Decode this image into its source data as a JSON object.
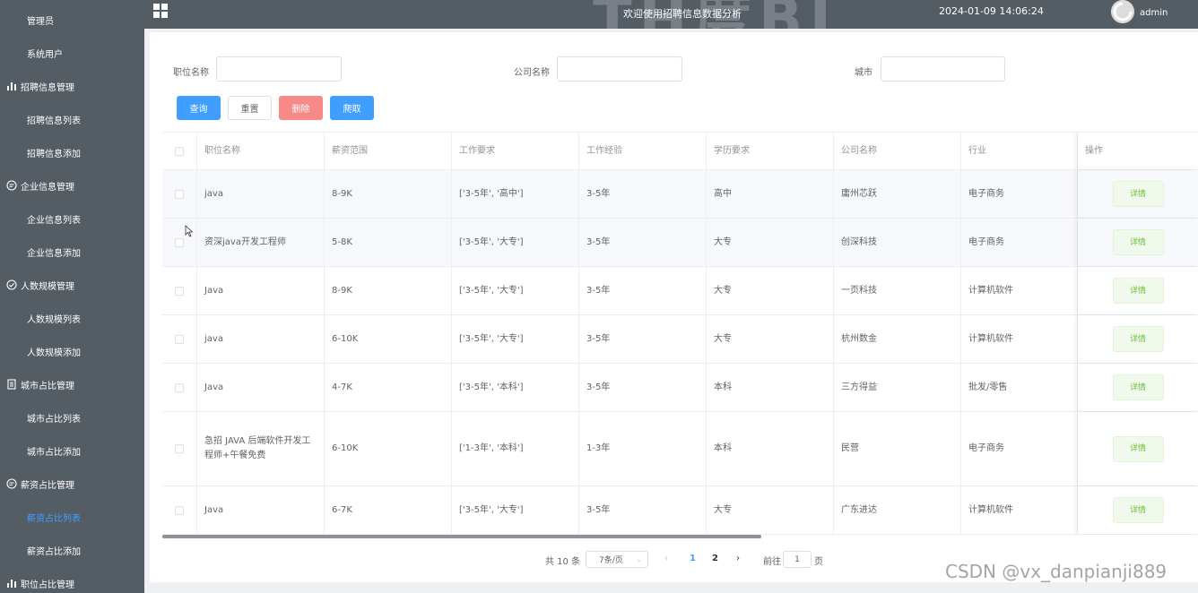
{
  "sidebar": {
    "items": [
      {
        "label": "管理员",
        "type": "child",
        "icon": "",
        "active": false
      },
      {
        "label": "系统用户",
        "type": "child",
        "icon": "",
        "active": false
      },
      {
        "label": "招聘信息管理",
        "type": "parent",
        "icon": "bar-chart-icon",
        "active": false
      },
      {
        "label": "招聘信息列表",
        "type": "child",
        "icon": "",
        "active": false
      },
      {
        "label": "招聘信息添加",
        "type": "child",
        "icon": "",
        "active": false
      },
      {
        "label": "企业信息管理",
        "type": "parent",
        "icon": "chat-icon",
        "active": false
      },
      {
        "label": "企业信息列表",
        "type": "child",
        "icon": "",
        "active": false
      },
      {
        "label": "企业信息添加",
        "type": "child",
        "icon": "",
        "active": false
      },
      {
        "label": "人数规模管理",
        "type": "parent",
        "icon": "check-circle-icon",
        "active": false
      },
      {
        "label": "人数规模列表",
        "type": "child",
        "icon": "",
        "active": false
      },
      {
        "label": "人数规模添加",
        "type": "child",
        "icon": "",
        "active": false
      },
      {
        "label": "城市占比管理",
        "type": "parent",
        "icon": "document-icon",
        "active": false
      },
      {
        "label": "城市占比列表",
        "type": "child",
        "icon": "",
        "active": false
      },
      {
        "label": "城市占比添加",
        "type": "child",
        "icon": "",
        "active": false
      },
      {
        "label": "薪资占比管理",
        "type": "parent",
        "icon": "chat-icon",
        "active": false
      },
      {
        "label": "薪资占比列表",
        "type": "child",
        "icon": "",
        "active": true
      },
      {
        "label": "薪资占比添加",
        "type": "child",
        "icon": "",
        "active": false
      },
      {
        "label": "职位占比管理",
        "type": "parent",
        "icon": "bar-chart-icon",
        "active": false
      }
    ],
    "active_color": "#409eff"
  },
  "header": {
    "title": "欢迎使用招聘信息数据分析",
    "time": "2024-01-09 14:06:24",
    "user": "admin",
    "bg_text": "TH度BL"
  },
  "search": {
    "job_label": "职位名称",
    "job_value": "",
    "company_label": "公司名称",
    "company_value": "",
    "city_label": "城市",
    "city_value": ""
  },
  "buttons": {
    "query": "查询",
    "reset": "重置",
    "delete": "删除",
    "crawl": "爬取"
  },
  "table": {
    "columns": [
      "职位名称",
      "薪资范围",
      "工作要求",
      "工作经验",
      "学历要求",
      "公司名称",
      "行业",
      "操作"
    ],
    "detail_label": "详情",
    "rows": [
      [
        "java",
        "8-9K",
        "['3-5年', '高中']",
        "3-5年",
        "高中",
        "庸州芯跃",
        "电子商务"
      ],
      [
        "资深java开发工程师",
        "5-8K",
        "['3-5年', '大专']",
        "3-5年",
        "大专",
        "创深科技",
        "电子商务"
      ],
      [
        "Java",
        "8-9K",
        "['3-5年', '大专']",
        "3-5年",
        "大专",
        "一页科技",
        "计算机软件"
      ],
      [
        "java",
        "6-10K",
        "['3-5年', '大专']",
        "3-5年",
        "大专",
        "杭州数金",
        "计算机软件"
      ],
      [
        "Java",
        "4-7K",
        "['3-5年', '本科']",
        "3-5年",
        "本科",
        "三方得益",
        "批发/零售"
      ],
      [
        "急招 JAVA 后端软件开发工程师+午餐免费",
        "6-10K",
        "['1-3年', '本科']",
        "1-3年",
        "本科",
        "民营",
        "电子商务"
      ],
      [
        "Java",
        "6-7K",
        "['3-5年', '大专']",
        "3-5年",
        "大专",
        "广东进达",
        "计算机软件"
      ]
    ]
  },
  "pagination": {
    "total": "共 10 条",
    "page_size": "7条/页",
    "pages": [
      "1",
      "2"
    ],
    "current": "1",
    "goto_label": "前往",
    "goto_value": "1",
    "page_suffix": "页"
  },
  "watermark": "CSDN @vx_danpianji889"
}
